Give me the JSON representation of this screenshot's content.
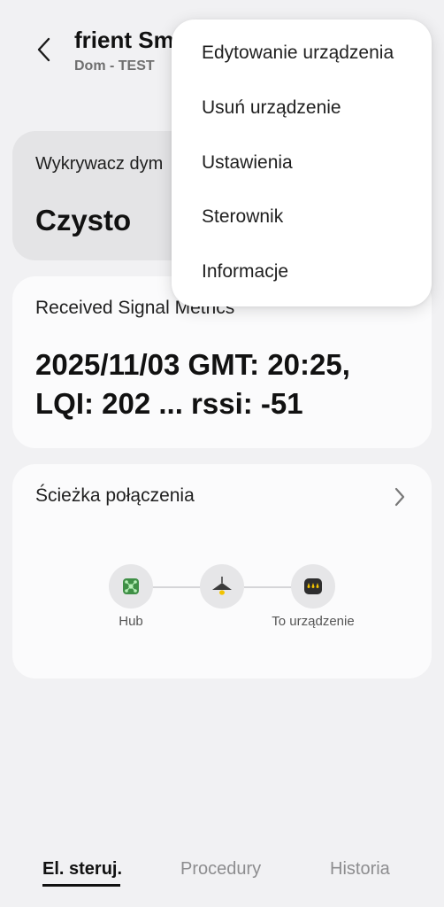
{
  "header": {
    "back_icon": "back-arrow-icon",
    "title": "frient Sm",
    "subtitle": "Dom - TEST"
  },
  "detector_card": {
    "label": "Wykrywacz dym",
    "value": "Czysto"
  },
  "signal_card": {
    "label": "Received Signal Metrics",
    "value": "2025/11/03 GMT: 20:25, LQI: 202 ... rssi: -51"
  },
  "path_card": {
    "label": "Ścieżka połączenia",
    "chevron_icon": "chevron-right-icon",
    "nodes": [
      {
        "label": "Hub",
        "icon": "hub-icon",
        "icon_color": "#4caf50"
      },
      {
        "label": "",
        "icon": "ceiling-lamp-icon",
        "icon_color": "#333333"
      },
      {
        "label": "To urządzenie",
        "icon": "water-drops-icon",
        "icon_color": "#f2c300"
      }
    ]
  },
  "bottom_nav": {
    "items": [
      "El. steruj.",
      "Procedury",
      "Historia"
    ],
    "active": "El. steruj."
  },
  "menu": {
    "items": [
      "Edytowanie urządzenia",
      "Usuń urządzenie",
      "Ustawienia",
      "Sterownik",
      "Informacje"
    ]
  },
  "colors": {
    "background": "#f1f1f3",
    "card": "#fbfbfc",
    "card_muted": "#e4e4e6",
    "text_secondary": "#6f6f6f"
  }
}
